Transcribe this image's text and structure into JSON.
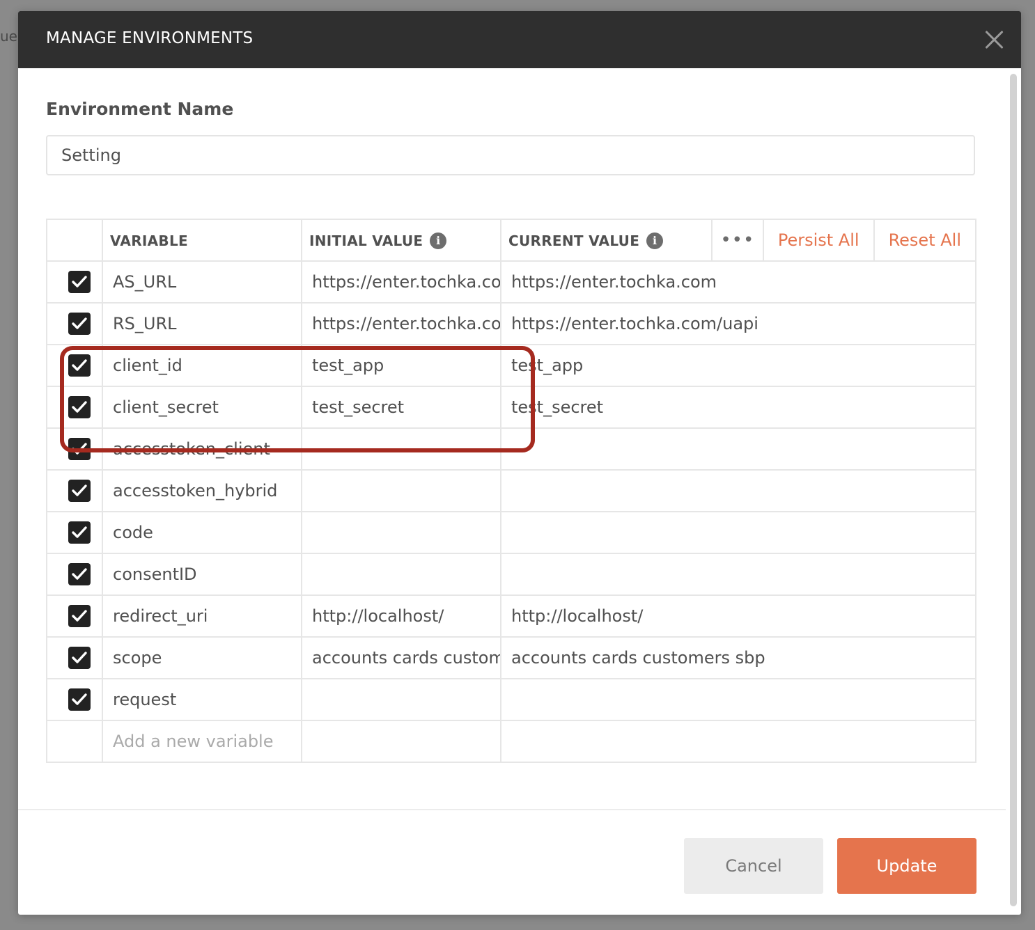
{
  "background_peek_text": "uer",
  "modal": {
    "title": "MANAGE ENVIRONMENTS",
    "close_icon": "close-icon"
  },
  "environment": {
    "label": "Environment Name",
    "value": "Setting"
  },
  "table": {
    "headers": {
      "variable": "VARIABLE",
      "initial_value": "INITIAL VALUE",
      "current_value": "CURRENT VALUE",
      "info_glyph": "i",
      "more_glyph": "•••",
      "persist_all": "Persist All",
      "reset_all": "Reset All"
    },
    "rows": [
      {
        "variable": "AS_URL",
        "initial": "https://enter.tochka.com",
        "current": "https://enter.tochka.com",
        "checked": true
      },
      {
        "variable": "RS_URL",
        "initial": "https://enter.tochka.com/uapi",
        "current": "https://enter.tochka.com/uapi",
        "checked": true
      },
      {
        "variable": "client_id",
        "initial": "test_app",
        "current": "test_app",
        "checked": true
      },
      {
        "variable": "client_secret",
        "initial": "test_secret",
        "current": "test_secret",
        "checked": true
      },
      {
        "variable": "accesstoken_client",
        "initial": "",
        "current": "",
        "checked": true
      },
      {
        "variable": "accesstoken_hybrid",
        "initial": "",
        "current": "",
        "checked": true
      },
      {
        "variable": "code",
        "initial": "",
        "current": "",
        "checked": true
      },
      {
        "variable": "consentID",
        "initial": "",
        "current": "",
        "checked": true
      },
      {
        "variable": "redirect_uri",
        "initial": "http://localhost/",
        "current": "http://localhost/",
        "checked": true
      },
      {
        "variable": "scope",
        "initial": "accounts cards customers sbp",
        "current": "accounts cards customers sbp",
        "checked": true
      },
      {
        "variable": "request",
        "initial": "",
        "current": "",
        "checked": true
      }
    ],
    "new_variable_placeholder": "Add a new variable"
  },
  "footer": {
    "cancel_label": "Cancel",
    "update_label": "Update"
  },
  "colors": {
    "accent": "#e5744d",
    "header_bg": "#2f2f2f",
    "highlight": "#a52a1f"
  }
}
